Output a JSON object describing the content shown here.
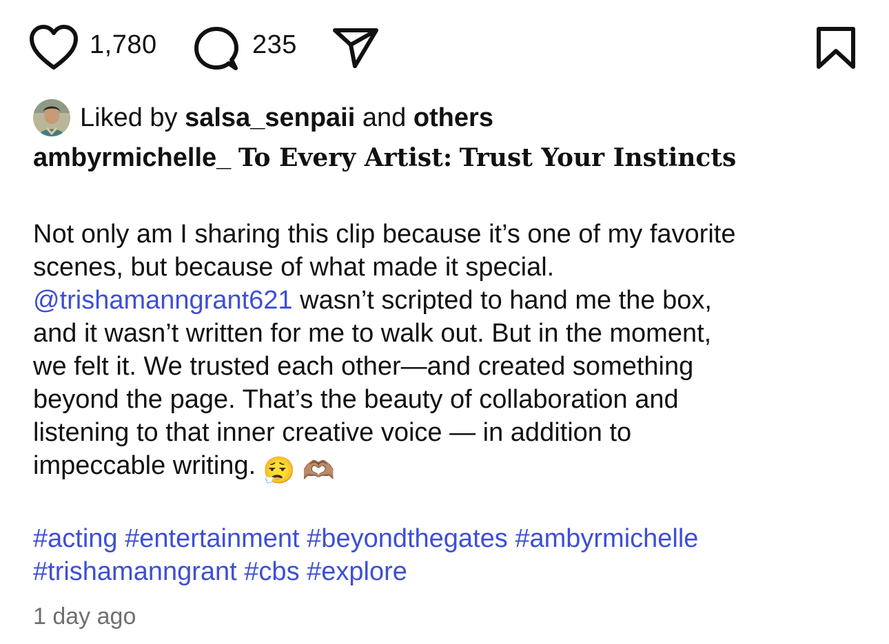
{
  "actions": {
    "like_count": "1,780",
    "comment_count": "235",
    "icons": [
      "heart-icon",
      "comment-icon",
      "share-icon",
      "bookmark-icon"
    ]
  },
  "likes": {
    "prefix": "Liked by",
    "first_user": "salsa_senpaii",
    "joiner": "and",
    "others": "others"
  },
  "caption": {
    "username": "ambyrmichelle_",
    "title_part1": "To Every Artist",
    "title_sep": ":",
    "title_part2": "Trust Your Instincts",
    "lines": [
      "Not only am I sharing this clip because it’s one of my favorite",
      "scenes, but because of what made it special.",
      "wasn’t scripted to hand me the box,",
      "and it wasn’t written for me to walk out. But in the moment,",
      "we felt it. We trusted each other—and created something",
      "beyond the page. That’s the beauty of collaboration and",
      "listening to that inner creative voice — in addition to",
      "impeccable writing."
    ],
    "mention": "@trishamanngrant621",
    "emojis": [
      "😮‍💨",
      "🫶🏽"
    ]
  },
  "hashtags": {
    "line1": [
      "#acting",
      "#entertainment",
      "#beyondthegates",
      "#ambyrmichelle"
    ],
    "line2": [
      "#trishamanngrant",
      "#cbs",
      "#explore"
    ]
  },
  "timestamp": "1 day ago",
  "colors": {
    "link": "#3d4fd6",
    "text": "#111111",
    "muted": "#6f6f6f"
  }
}
